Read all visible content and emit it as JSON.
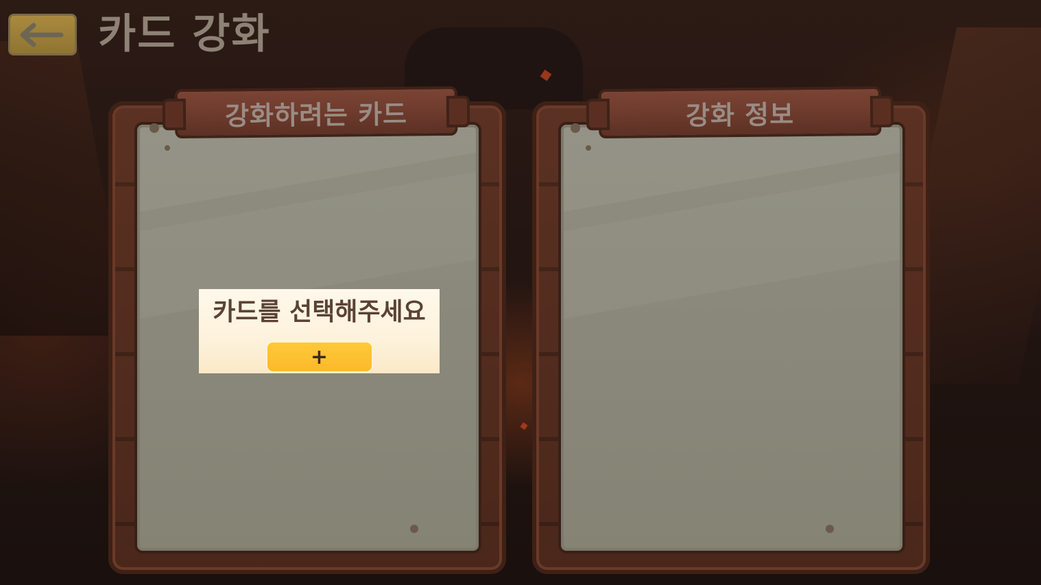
{
  "header": {
    "back_icon": "arrow-left-icon",
    "title": "카드 강화"
  },
  "left_panel": {
    "title": "강화하려는 카드",
    "prompt": "카드를 선택해주세요",
    "add_button_label": "+",
    "add_icon": "plus-icon"
  },
  "right_panel": {
    "title": "강화 정보"
  },
  "colors": {
    "back_button": "#a98a3e",
    "banner": "#6c3a2c",
    "paper": "#8a8879",
    "add_button": "#fbb92a",
    "prompt_text": "#5b4236"
  }
}
